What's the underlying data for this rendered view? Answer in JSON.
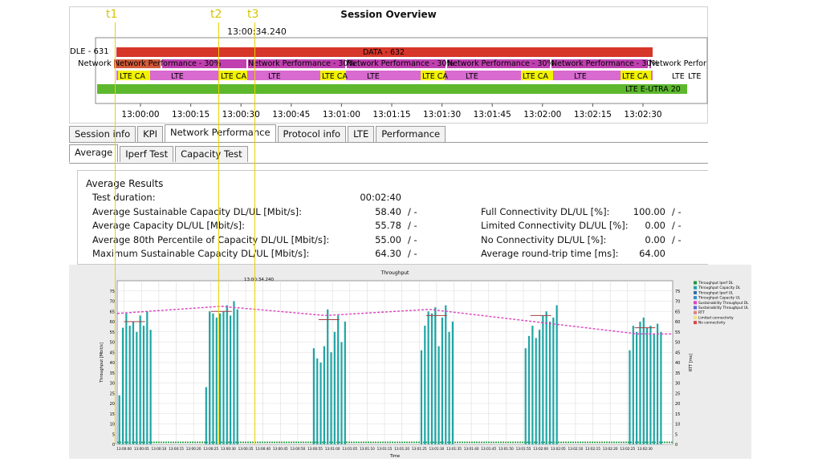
{
  "overview": {
    "title": "Session Overview",
    "cursor_time": "13:00:34.240",
    "rows": {
      "row1_left": "DLE - 631",
      "row1_bar": "DATA - 632",
      "row3_tail": "LTE",
      "row4_bar": "LTE E-UTRA 20",
      "np_label": "Network Performance - 30%",
      "np_start": "Network",
      "np_end": "Network Perfor"
    },
    "ticks": [
      "13:00:00",
      "13:00:15",
      "13:00:30",
      "13:00:45",
      "13:01:00",
      "13:01:15",
      "13:01:30",
      "13:01:45",
      "13:02:00",
      "13:02:15",
      "13:02:30"
    ],
    "colors": {
      "data_bar": "#d7362a",
      "np_bar": "#c040b0",
      "lte_bar": "#d86ad0",
      "ca_block": "#f2f200",
      "eutra_bar": "#5db82e"
    }
  },
  "tabs": {
    "main": [
      "Session info",
      "KPI",
      "Network Performance",
      "Protocol info",
      "LTE",
      "Performance"
    ],
    "main_active": "Network Performance",
    "sub": [
      "Average",
      "Iperf Test",
      "Capacity Test"
    ],
    "sub_active": "Average"
  },
  "results": {
    "title": "Average Results",
    "left": [
      {
        "label": "Test duration:",
        "value": "00:02:40",
        "sep": ""
      },
      {
        "label": "Average Sustainable Capacity DL/UL [Mbit/s]:",
        "value": "58.40",
        "sep": "/  -"
      },
      {
        "label": "Average Capacity DL/UL [Mbit/s]:",
        "value": "55.78",
        "sep": "/  -"
      },
      {
        "label": "Average 80th Percentile of Capacity DL/UL [Mbit/s]:",
        "value": "55.00",
        "sep": "/  -"
      },
      {
        "label": "Maximum Sustainable Capacity DL/UL [Mbit/s]:",
        "value": "64.30",
        "sep": "/  -"
      }
    ],
    "right": [
      {
        "label": "Full Connectivity DL/UL [%]:",
        "value": "100.00",
        "sep": "/  -"
      },
      {
        "label": "Limited Connectivity DL/UL [%]:",
        "value": "0.00",
        "sep": "/  -"
      },
      {
        "label": "No Connectivity DL/UL [%]:",
        "value": "0.00",
        "sep": "/  -"
      },
      {
        "label": "Average round-trip time [ms]:",
        "value": "64.00",
        "sep": ""
      }
    ]
  },
  "chart": {
    "title": "Throughput",
    "cursor_time": "13:00:34.240",
    "ylabel": "Throughput [Mbit/s]",
    "ylabel_right": "RTT [ms]",
    "xlabel": "Time",
    "legend": [
      {
        "name": "Throughput Iperf DL",
        "color": "#1a9a3a"
      },
      {
        "name": "Throughput Capacity DL",
        "color": "#1fa5a5"
      },
      {
        "name": "Throughput Iperf UL",
        "color": "#2a6fb0"
      },
      {
        "name": "Throughput Capacity UL",
        "color": "#3a8ad0"
      },
      {
        "name": "Sustainability Throughput DL",
        "color": "#e040c0"
      },
      {
        "name": "Sustainability Throughput UL",
        "color": "#6060e0"
      },
      {
        "name": "RTT",
        "color": "#e08080"
      },
      {
        "name": "Limited connectivity",
        "color": "#f0e080"
      },
      {
        "name": "No connectivity",
        "color": "#e04040"
      }
    ]
  },
  "chart_data": {
    "type": "bar",
    "ylim": [
      0,
      80
    ],
    "y_ticks": [
      0,
      5,
      10,
      15,
      20,
      25,
      30,
      35,
      40,
      45,
      50,
      55,
      60,
      65,
      70,
      75
    ],
    "x_ticks": [
      "13:00:00",
      "13:00:05",
      "13:00:10",
      "13:00:15",
      "13:00:20",
      "13:00:25",
      "13:00:30",
      "13:00:35",
      "13:00:40",
      "13:00:45",
      "13:00:50",
      "13:00:55",
      "13:01:00",
      "13:01:05",
      "13:01:10",
      "13:01:15",
      "13:01:20",
      "13:01:25",
      "13:01:30",
      "13:01:35",
      "13:01:40",
      "13:01:45",
      "13:01:50",
      "13:01:55",
      "13:02:00",
      "13:02:05",
      "13:02:10",
      "13:02:15",
      "13:02:20",
      "13:02:25",
      "13:02:30"
    ],
    "capacity_bursts": [
      {
        "start": 0,
        "values": [
          24,
          57,
          64,
          58,
          60,
          55,
          63,
          58,
          65,
          56
        ]
      },
      {
        "start": 25,
        "values": [
          28,
          65,
          64,
          62,
          64,
          65,
          68,
          63,
          70,
          66
        ]
      },
      {
        "start": 56,
        "values": [
          47,
          42,
          40,
          48,
          66,
          45,
          55,
          63,
          50,
          60
        ]
      },
      {
        "start": 87,
        "values": [
          46,
          58,
          65,
          64,
          67,
          48,
          62,
          68,
          55,
          60
        ]
      },
      {
        "start": 117,
        "values": [
          47,
          53,
          58,
          52,
          56,
          63,
          65,
          60,
          62,
          68
        ]
      },
      {
        "start": 147,
        "values": [
          46,
          58,
          55,
          60,
          62,
          57,
          58,
          54,
          59,
          55
        ]
      }
    ],
    "sustainability_dl": [
      [
        0,
        64
      ],
      [
        30,
        67.5
      ],
      [
        60,
        63
      ],
      [
        90,
        66
      ],
      [
        120,
        60
      ],
      [
        150,
        54
      ],
      [
        160,
        54
      ]
    ],
    "iperf_dl_baseline": 1
  }
}
